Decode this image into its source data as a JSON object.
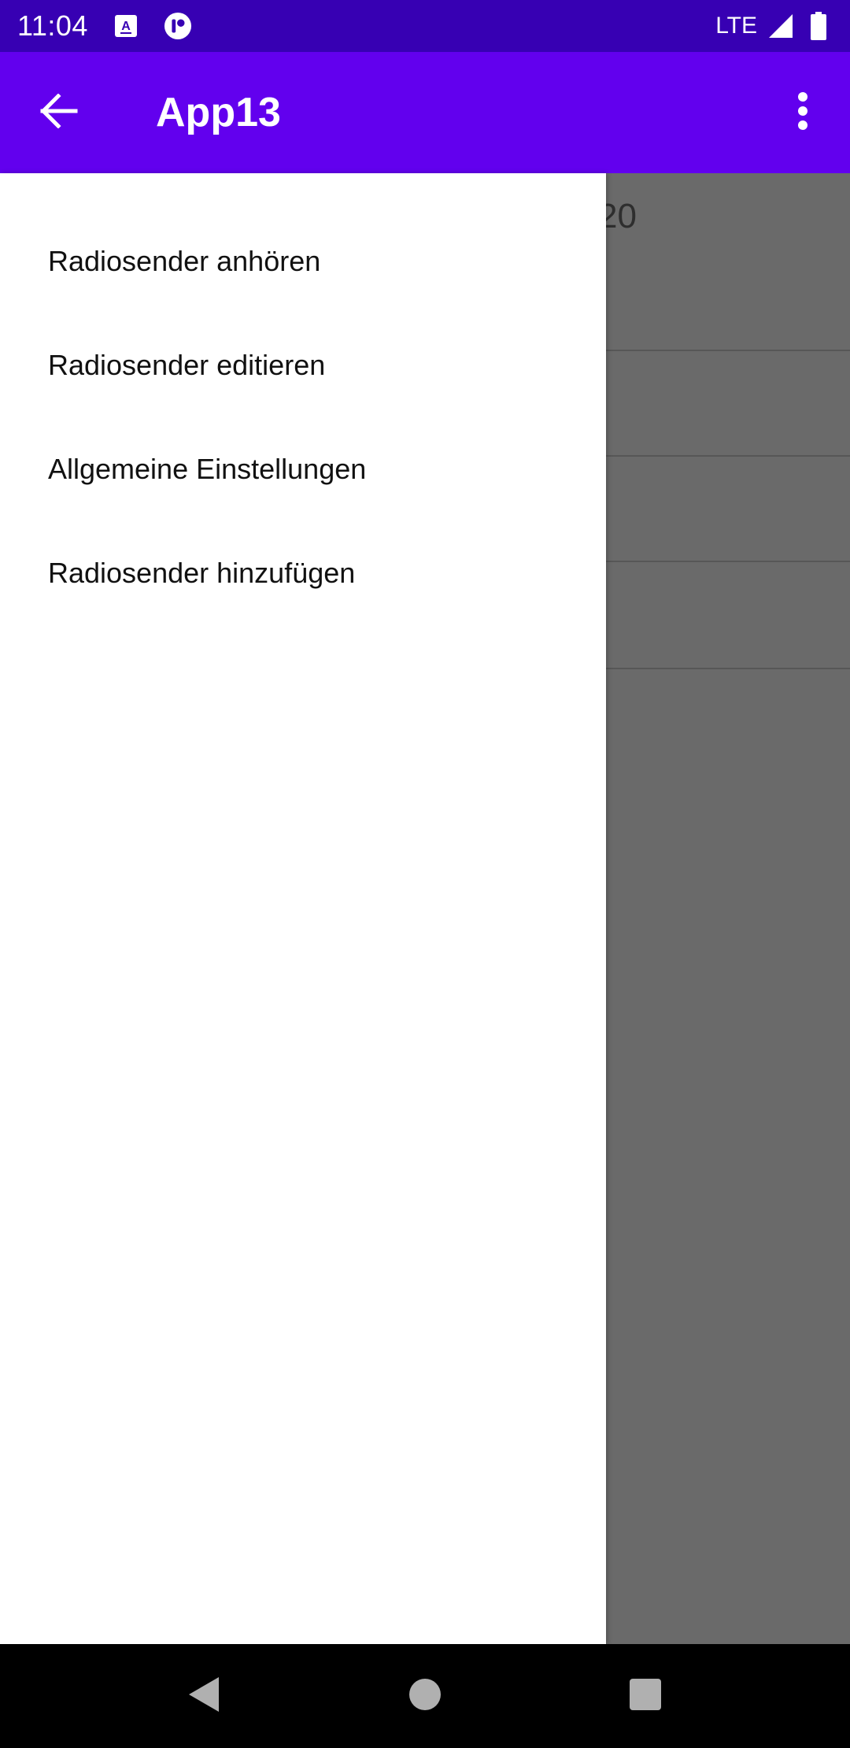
{
  "status_bar": {
    "time": "11:04",
    "network": "LTE",
    "icons": [
      "accessibility-icon",
      "notification-icon",
      "signal-icon",
      "battery-icon"
    ]
  },
  "app_bar": {
    "title": "App13",
    "back_icon": "arrow-back-icon",
    "menu_icon": "more-vert-icon",
    "color": "#6200ee",
    "status_color": "#3700b3"
  },
  "background_content": {
    "peek_text": "20"
  },
  "drawer": {
    "items": [
      {
        "label": "Radiosender anhören"
      },
      {
        "label": "Radiosender editieren"
      },
      {
        "label": "Allgemeine Einstellungen"
      },
      {
        "label": "Radiosender hinzufügen"
      }
    ]
  },
  "nav_bar": {
    "icons": [
      "back-triangle-icon",
      "home-circle-icon",
      "recents-square-icon"
    ]
  }
}
